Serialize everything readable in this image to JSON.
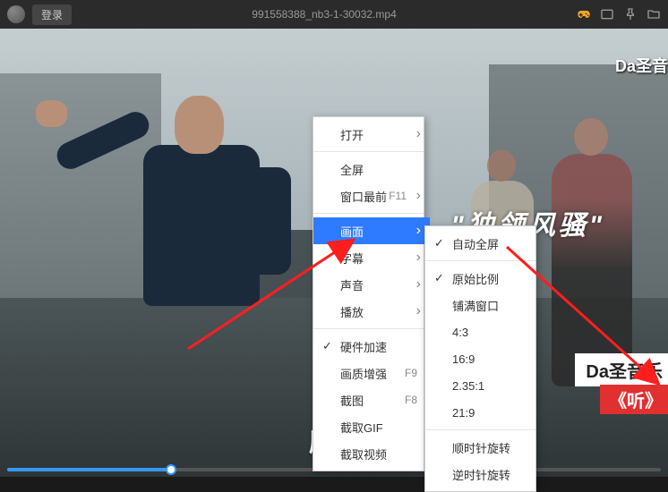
{
  "titlebar": {
    "login": "登录",
    "filename": "991558388_nb3-1-30032.mp4"
  },
  "video": {
    "watermark_top": "Da圣音",
    "overlay_text": "\"独领风骚\"",
    "label_text": "Da圣音乐",
    "sub_label": "《听》",
    "subtitle": "愿喧"
  },
  "menu1": {
    "open": "打开",
    "fullscreen": "全屏",
    "topmost": "窗口最前",
    "topmost_key": "F11",
    "picture": "画面",
    "subtitle": "字幕",
    "audio": "声音",
    "playback": "播放",
    "hwaccel": "硬件加速",
    "enhance": "画质增强",
    "enhance_key": "F9",
    "screenshot": "截图",
    "screenshot_key": "F8",
    "gif": "截取GIF",
    "clip": "截取视频"
  },
  "menu2": {
    "auto_fs": "自动全屏",
    "orig_ratio": "原始比例",
    "fill_win": "铺满窗口",
    "r43": "4:3",
    "r169": "16:9",
    "r2351": "2.35:1",
    "r219": "21:9",
    "rot_cw": "顺时针旋转",
    "rot_ccw": "逆时针旋转"
  }
}
